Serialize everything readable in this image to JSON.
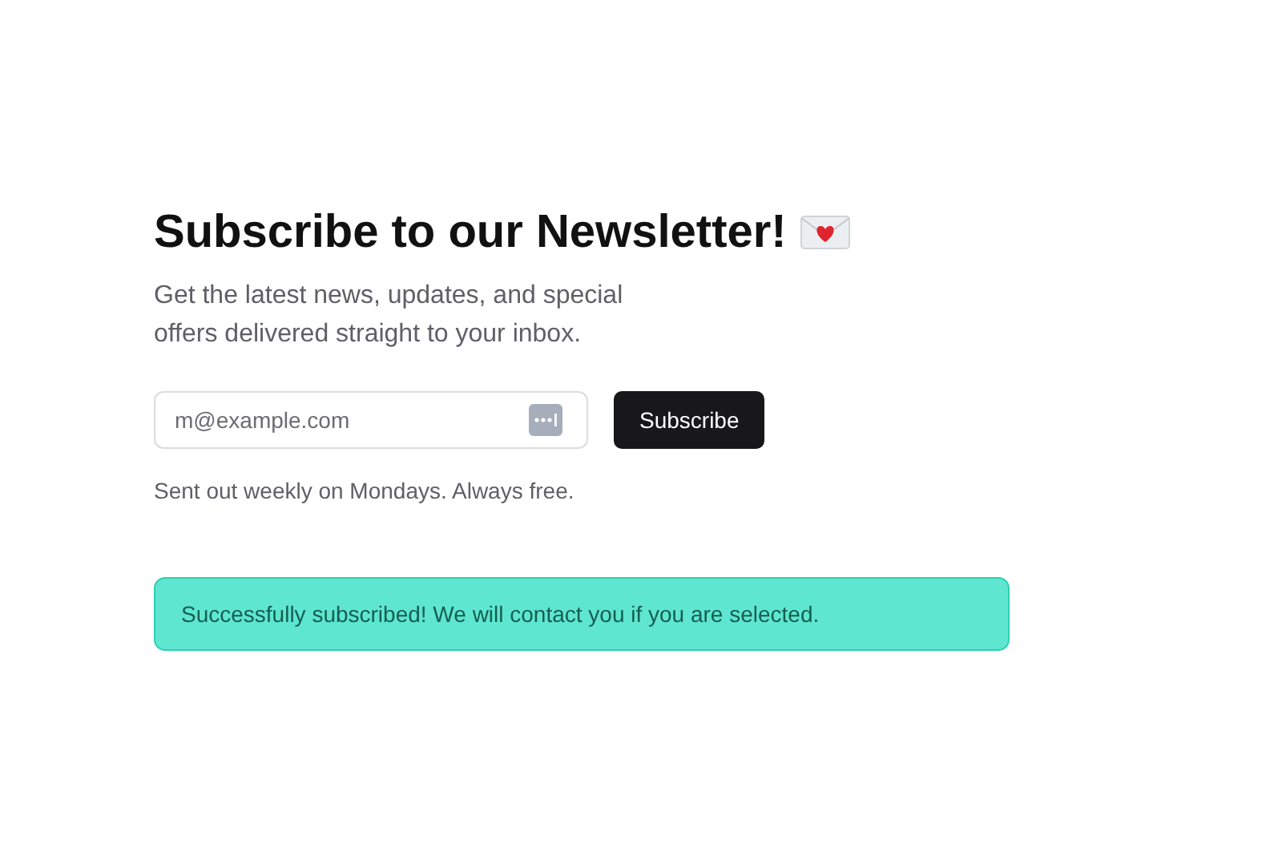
{
  "heading": "Subscribe to our Newsletter!",
  "description": "Get the latest news, updates, and special offers delivered straight to your inbox.",
  "email_field": {
    "placeholder": "m@example.com"
  },
  "subscribe_button": "Subscribe",
  "note": "Sent out weekly on Mondays. Always free.",
  "alert": {
    "kind": "success",
    "message": "Successfully subscribed! We will contact you if you are selected."
  }
}
